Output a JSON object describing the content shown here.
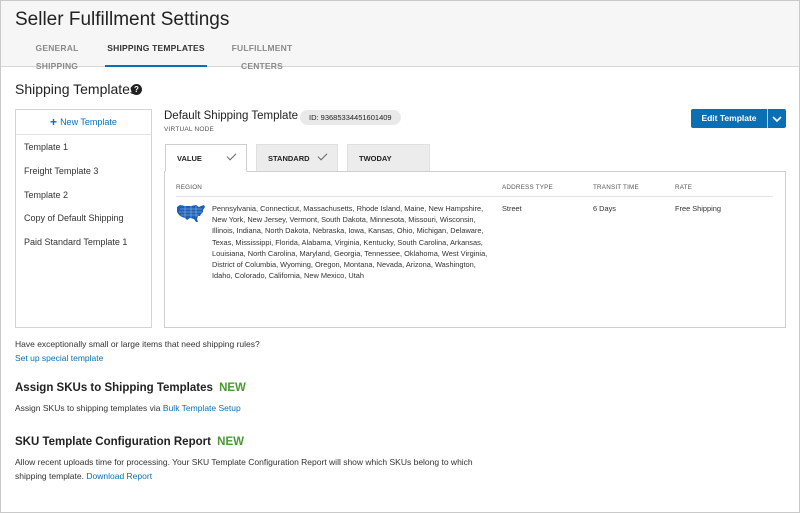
{
  "app": {
    "title": "Seller Fulfillment Settings"
  },
  "tabs": [
    "GENERAL SHIPPING",
    "SHIPPING TEMPLATES",
    "FULFILLMENT CENTERS"
  ],
  "active_tab": "SHIPPING TEMPLATES",
  "section": {
    "title": "Shipping Templates",
    "help_icon": "?"
  },
  "sidebar": {
    "new_template": "New Template",
    "items": [
      {
        "label": "Template 1"
      },
      {
        "label": "Freight Template 3"
      },
      {
        "label": "Template 2"
      },
      {
        "label": "Copy of Default Shipping"
      },
      {
        "label": "Paid Standard Template 1"
      }
    ]
  },
  "detail": {
    "title": "Default Shipping Template",
    "subtitle": "VIRTUAL NODE",
    "id": "ID: 93685334451601409",
    "edit_label": "Edit Template",
    "tabs": [
      {
        "label": "VALUE",
        "checked": true
      },
      {
        "label": "STANDARD",
        "checked": true
      },
      {
        "label": "TWODAY",
        "checked": false
      }
    ],
    "active_tab": "VALUE",
    "columns": [
      "REGION",
      "ADDRESS TYPE",
      "TRANSIT TIME",
      "RATE"
    ],
    "row": {
      "regions": "Pennsylvania, Connecticut, Massachusetts, Rhode Island, Maine, New Hampshire, New York, New Jersey, Vermont, South Dakota, Minnesota, Missouri, Wisconsin, Illinois, Indiana, North Dakota, Nebraska, Iowa, Kansas, Ohio, Michigan, Delaware, Texas, Mississippi, Florida, Alabama, Virginia, Kentucky, South Carolina, Arkansas, Louisiana, North Carolina, Maryland, Georgia, Tennessee, Oklahoma, West Virginia, District of Columbia, Wyoming, Oregon, Montana, Nevada, Arizona, Washington, Idaho, Colorado, California, New Mexico, Utah",
      "address_type": "Street",
      "transit_time": "6 Days",
      "rate": "Free Shipping"
    }
  },
  "special": {
    "question": "Have exceptionally small or large items that need shipping rules?",
    "link": "Set up special template"
  },
  "assign": {
    "title": "Assign SKUs to Shipping Templates",
    "badge": "NEW",
    "text": "Assign SKUs to shipping templates via",
    "link": "Bulk Template Setup"
  },
  "report": {
    "title": "SKU Template Configuration Report",
    "badge": "NEW",
    "text": "Allow recent uploads time for processing. Your SKU Template Configuration Report will show which SKUs belong to which shipping template.",
    "link": "Download Report"
  },
  "colors": {
    "accent": "#0b6fb3",
    "new_badge": "#4a9b2f"
  },
  "icons": {
    "new_template": "plus-icon",
    "help": "help-circle-icon",
    "edit_dropdown": "chevron-down-icon",
    "region": "us-map-icon",
    "tab_check": "checkmark-icon"
  }
}
